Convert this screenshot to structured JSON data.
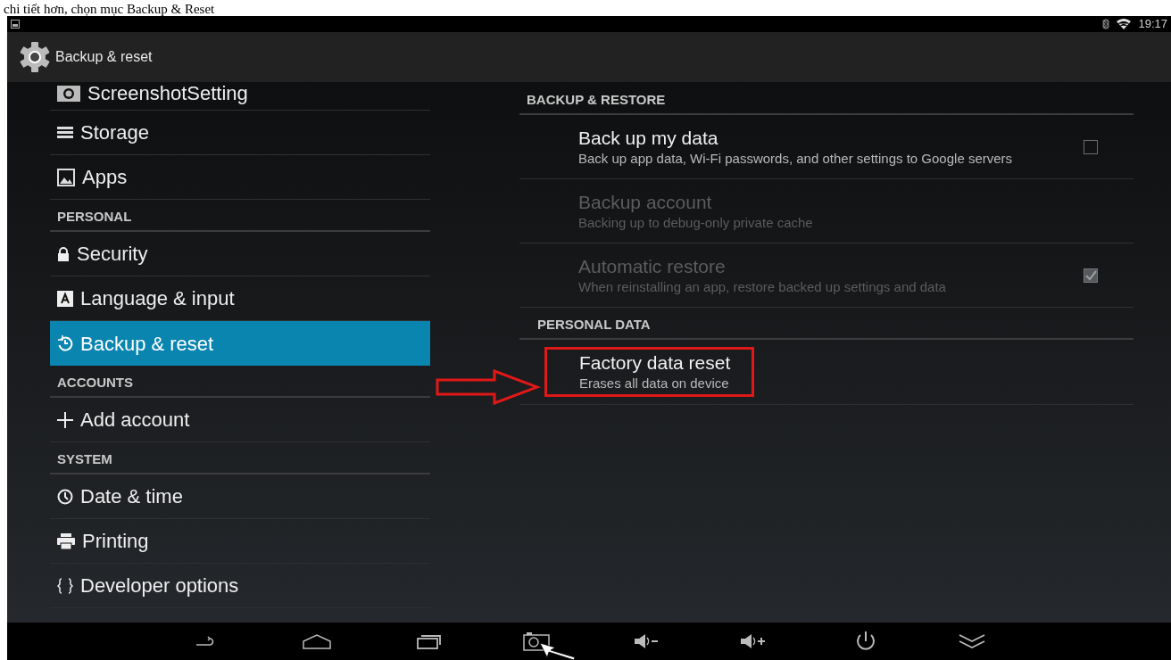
{
  "caption": "chi tiết hơn, chọn mục Backup & Reset",
  "status_bar": {
    "time": "19:17"
  },
  "action_bar": {
    "title": "Backup & reset"
  },
  "sidebar": {
    "items": [
      {
        "kind": "item",
        "label": "ScreenshotSetting",
        "selected": false
      },
      {
        "kind": "item",
        "label": "Storage",
        "selected": false
      },
      {
        "kind": "item",
        "label": "Apps",
        "selected": false
      },
      {
        "kind": "header",
        "label": "PERSONAL"
      },
      {
        "kind": "item",
        "label": "Security",
        "selected": false
      },
      {
        "kind": "item",
        "label": "Language & input",
        "selected": false
      },
      {
        "kind": "item",
        "label": "Backup & reset",
        "selected": true
      },
      {
        "kind": "header",
        "label": "ACCOUNTS"
      },
      {
        "kind": "item",
        "label": "Add account",
        "selected": false
      },
      {
        "kind": "header",
        "label": "SYSTEM"
      },
      {
        "kind": "item",
        "label": "Date & time",
        "selected": false
      },
      {
        "kind": "item",
        "label": "Printing",
        "selected": false
      },
      {
        "kind": "item",
        "label": "Developer options",
        "selected": false
      }
    ]
  },
  "sections": [
    {
      "header": "BACKUP & RESTORE",
      "items": [
        {
          "title": "Back up my data",
          "summary": "Back up app data, Wi-Fi passwords, and other settings to Google servers",
          "disabled": false,
          "kind": "checkbox",
          "checked": false,
          "highlighted": false
        },
        {
          "title": "Backup account",
          "summary": "Backing up to debug-only private cache",
          "disabled": true,
          "kind": "plain",
          "highlighted": false
        },
        {
          "title": "Automatic restore",
          "summary": "When reinstalling an app, restore backed up settings and data",
          "disabled": true,
          "kind": "checkbox",
          "checked": true,
          "highlighted": false
        }
      ]
    },
    {
      "header": "PERSONAL DATA",
      "items": [
        {
          "title": "Factory data reset",
          "summary": "Erases all data on device",
          "disabled": false,
          "kind": "plain",
          "highlighted": true
        }
      ]
    }
  ]
}
